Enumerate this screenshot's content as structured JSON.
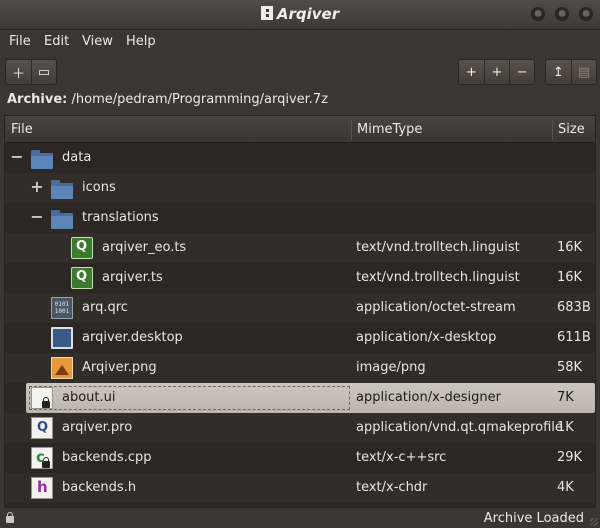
{
  "window": {
    "title": "Arqiver"
  },
  "menu": [
    "File",
    "Edit",
    "View",
    "Help"
  ],
  "toolbar": {
    "left": [
      {
        "icon": "new-archive-icon",
        "glyph": "＋"
      },
      {
        "icon": "open-folder-icon",
        "glyph": "▭"
      }
    ],
    "middle": [
      {
        "icon": "add-file-icon",
        "glyph": "+"
      },
      {
        "icon": "add-folder-icon",
        "glyph": "+"
      },
      {
        "icon": "remove-icon",
        "glyph": "−"
      }
    ],
    "right": [
      {
        "icon": "extract-icon",
        "glyph": "↥",
        "enabled": true
      },
      {
        "icon": "view-icon",
        "glyph": "▤",
        "enabled": false
      }
    ]
  },
  "archive": {
    "label": "Archive:",
    "path": "/home/pedram/Programming/arqiver.7z"
  },
  "columns": {
    "file": "File",
    "mime": "MimeType",
    "size": "Size"
  },
  "rows": [
    {
      "name": "data",
      "mime": "",
      "size": "",
      "icon": "folder-icon",
      "expander": "−",
      "selected": false
    },
    {
      "name": "icons",
      "mime": "",
      "size": "",
      "icon": "folder-icon",
      "expander": "+",
      "selected": false
    },
    {
      "name": "translations",
      "mime": "",
      "size": "",
      "icon": "folder-icon",
      "expander": "−",
      "selected": false
    },
    {
      "name": "arqiver_eo.ts",
      "mime": "text/vnd.trolltech.linguist",
      "size": "16K",
      "icon": "qt-linguist-icon",
      "selected": false
    },
    {
      "name": "arqiver.ts",
      "mime": "text/vnd.trolltech.linguist",
      "size": "16K",
      "icon": "qt-linguist-icon",
      "selected": false
    },
    {
      "name": "arq.qrc",
      "mime": "application/octet-stream",
      "size": "683B",
      "icon": "binary-file-icon",
      "selected": false
    },
    {
      "name": "arqiver.desktop",
      "mime": "application/x-desktop",
      "size": "611B",
      "icon": "desktop-file-icon",
      "selected": false
    },
    {
      "name": "Arqiver.png",
      "mime": "image/png",
      "size": "58K",
      "icon": "image-file-icon",
      "selected": false
    },
    {
      "name": "about.ui",
      "mime": "application/x-designer",
      "size": "7K",
      "icon": "ui-file-icon",
      "selected": true
    },
    {
      "name": "arqiver.pro",
      "mime": "application/vnd.qt.qmakeprofile",
      "size": "1K",
      "icon": "qmake-file-icon",
      "selected": false
    },
    {
      "name": "backends.cpp",
      "mime": "text/x-c++src",
      "size": "29K",
      "icon": "cpp-file-icon",
      "selected": false
    },
    {
      "name": "backends.h",
      "mime": "text/x-chdr",
      "size": "4K",
      "icon": "header-file-icon",
      "selected": false
    }
  ],
  "bin_text": [
    "0101",
    "1001"
  ],
  "status": {
    "text": "Archive Loaded"
  },
  "colors": {
    "background": "#3c3632",
    "selection": "#c6beb6",
    "folder": "#5c86b8"
  }
}
